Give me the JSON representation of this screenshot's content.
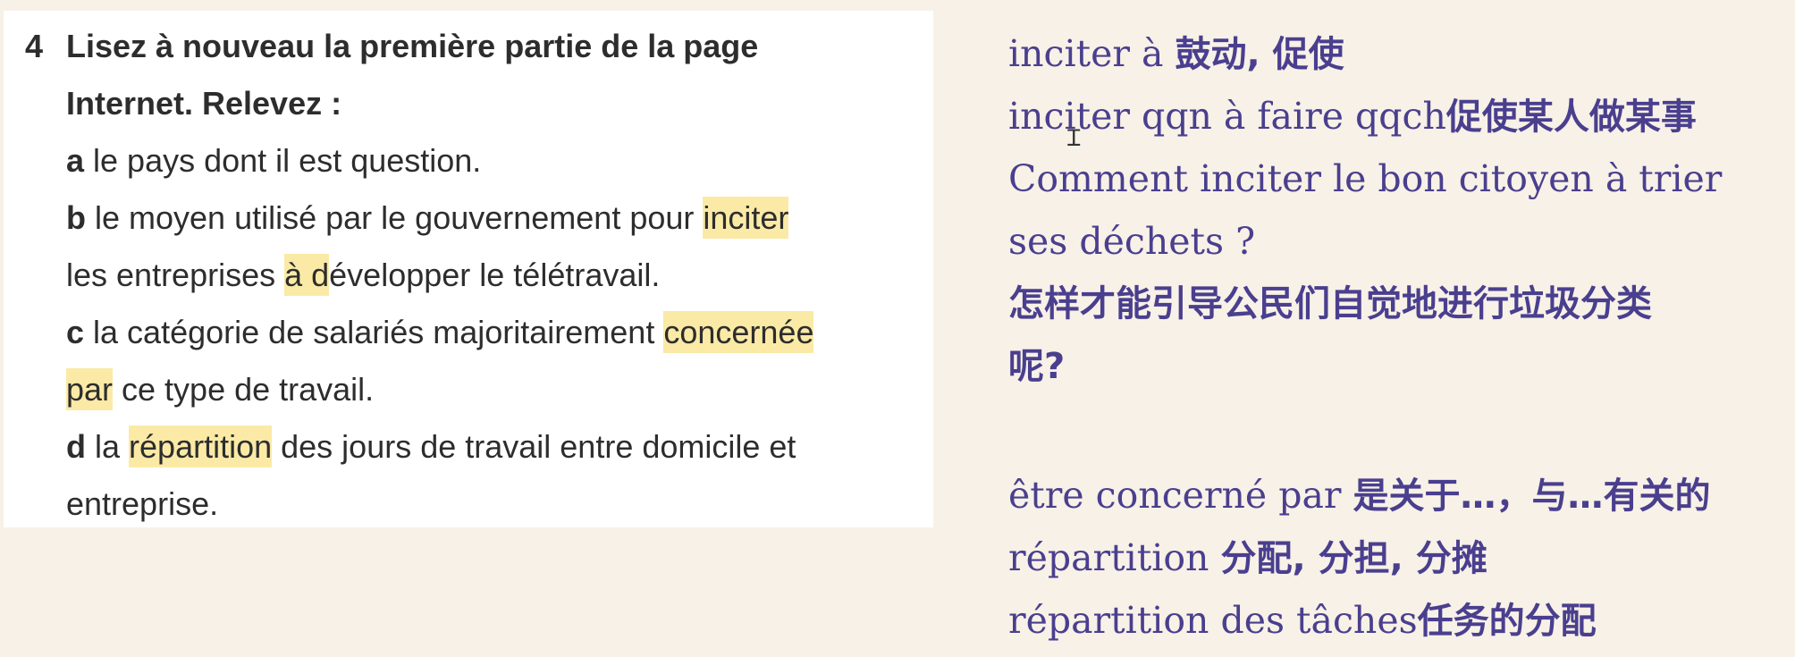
{
  "textbook": {
    "number": "4",
    "title_line1": "Lisez à nouveau la première partie de la page",
    "title_line2": "Internet. Relevez :",
    "item_a": {
      "letter": "a",
      "text": " le pays dont il est question."
    },
    "item_b": {
      "letter": "b",
      "pre": " le moyen utilisé par le gouvernement pour ",
      "hl1": "inciter",
      "line2_pre": "les entreprises ",
      "hl2": "à d",
      "line2_post": "évelopper le télétravail."
    },
    "item_c": {
      "letter": "c",
      "pre": " la catégorie de salariés majoritairement ",
      "hl1": "concernée",
      "hl2": "par",
      "line2_post": " ce type de travail."
    },
    "item_d": {
      "letter": "d",
      "pre": " la ",
      "hl1": "répartition",
      "post": " des jours de travail entre domicile et",
      "line2": "entreprise."
    }
  },
  "notes": {
    "n1_fr": "inciter à ",
    "n1_zh": "鼓动, 促使",
    "n2_fr": "inciter qqn à faire qqch",
    "n2_zh": "促使某人做某事",
    "n3_fr": "Comment inciter le bon citoyen à trier",
    "n4_fr": "ses déchets ?",
    "n5_zh": "怎样才能引导公民们自觉地进行垃圾分类",
    "n6_zh": "呢?",
    "n7_fr": "être concerné par  ",
    "n7_zh": "是关于…，与…有关的",
    "n8_fr": "répartition  ",
    "n8_zh": "分配, 分担, 分摊",
    "n9_fr": "répartition des tâches",
    "n9_zh": "任务的分配"
  },
  "colors": {
    "note_text": "#4a3f8e",
    "highlight": "#fbeaa6",
    "background": "#f7f1e7"
  }
}
